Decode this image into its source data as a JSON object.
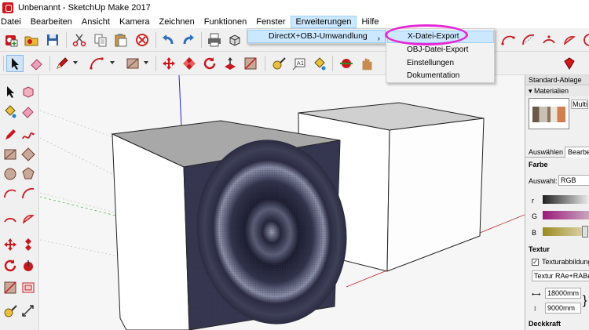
{
  "window": {
    "title": "Unbenannt - SketchUp Make 2017"
  },
  "menubar": {
    "items": [
      "Datei",
      "Bearbeiten",
      "Ansicht",
      "Kamera",
      "Zeichnen",
      "Funktionen",
      "Fenster",
      "Erweiterungen",
      "Hilfe"
    ],
    "active": "Erweiterungen"
  },
  "extensions_menu": {
    "item": "DirectX+OBJ-Umwandlung",
    "arrow": "›"
  },
  "submenu": {
    "items": [
      "X-Datei-Export",
      "OBJ-Datei-Export",
      "Einstellungen",
      "Dokumentation"
    ],
    "highlighted": "X-Datei-Export"
  },
  "right_panel": {
    "tray_title": "Standard-Ablage",
    "materials_label": "Materialien",
    "material_name": "Multi",
    "tabs": [
      "Auswählen",
      "Bearbe"
    ],
    "color_label": "Farbe",
    "picker_label": "Auswahl:",
    "picker_value": "RGB",
    "channels": [
      "r",
      "G",
      "B"
    ],
    "texture_label": "Textur",
    "texture_checkbox_label": "Texturabbildung",
    "texture_file": "Textur RAe+RABe",
    "width": "18000mm",
    "height": "9000mm",
    "opacity_label": "Deckkraft"
  },
  "colors": {
    "highlight": "#cce8ff",
    "highlight_border": "#99d1ff",
    "annotation": "#e628d6",
    "sketchup_red": "#c8181e"
  }
}
